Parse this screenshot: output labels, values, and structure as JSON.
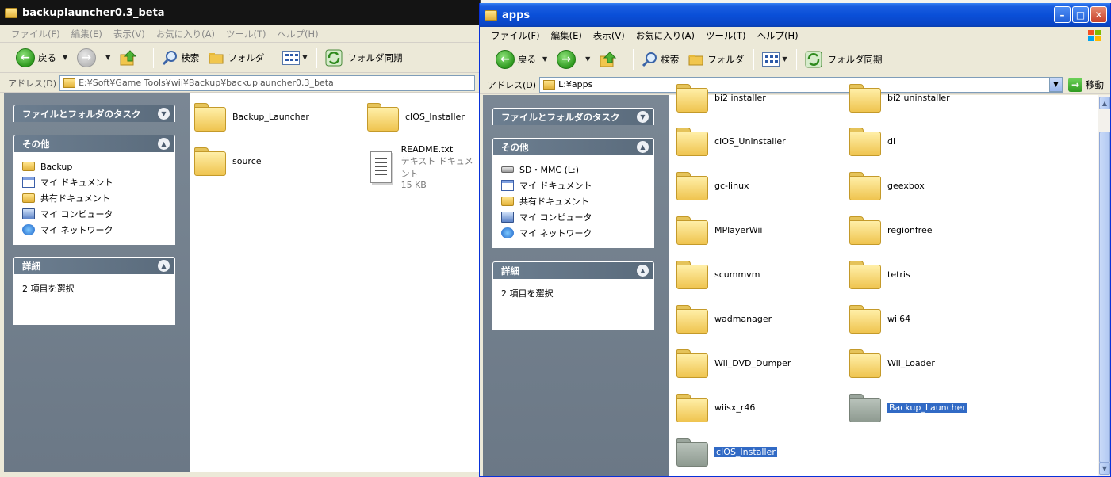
{
  "left_window": {
    "title": "backuplauncher0.3_beta",
    "menu": [
      "ファイル(F)",
      "編集(E)",
      "表示(V)",
      "お気に入り(A)",
      "ツール(T)",
      "ヘルプ(H)"
    ],
    "toolbar": {
      "back": "戻る",
      "search": "検索",
      "folders": "フォルダ",
      "sync": "フォルダ同期"
    },
    "address_label": "アドレス(D)",
    "address": "E:¥Soft¥Game Tools¥wii¥Backup¥backuplauncher0.3_beta",
    "tasks_header": "ファイルとフォルダのタスク",
    "other_header": "その他",
    "other_items": [
      "Backup",
      "マイ ドキュメント",
      "共有ドキュメント",
      "マイ コンピュータ",
      "マイ ネットワーク"
    ],
    "details_header": "詳細",
    "details_text": "2 項目を選択",
    "files": [
      {
        "name": "Backup_Launcher",
        "type": "folder"
      },
      {
        "name": "cIOS_Installer",
        "type": "folder"
      },
      {
        "name": "source",
        "type": "folder"
      },
      {
        "name": "README.txt",
        "type": "text",
        "kind": "テキスト ドキュメント",
        "size": "15 KB"
      }
    ]
  },
  "right_window": {
    "title": "apps",
    "menu": [
      "ファイル(F)",
      "編集(E)",
      "表示(V)",
      "お気に入り(A)",
      "ツール(T)",
      "ヘルプ(H)"
    ],
    "toolbar": {
      "back": "戻る",
      "search": "検索",
      "folders": "フォルダ",
      "sync": "フォルダ同期"
    },
    "address_label": "アドレス(D)",
    "address": "L:¥apps",
    "go": "移動",
    "tasks_header": "ファイルとフォルダのタスク",
    "other_header": "その他",
    "other_items": [
      "SD・MMC (L:)",
      "マイ ドキュメント",
      "共有ドキュメント",
      "マイ コンピュータ",
      "マイ ネットワーク"
    ],
    "details_header": "詳細",
    "details_text": "2 項目を選択",
    "files": [
      {
        "name": "bi2 installer"
      },
      {
        "name": "bi2 uninstaller"
      },
      {
        "name": "cIOS_Uninstaller"
      },
      {
        "name": "di"
      },
      {
        "name": "gc-linux"
      },
      {
        "name": "geexbox"
      },
      {
        "name": "MPlayerWii"
      },
      {
        "name": "regionfree"
      },
      {
        "name": "scummvm"
      },
      {
        "name": "tetris"
      },
      {
        "name": "wadmanager"
      },
      {
        "name": "wii64"
      },
      {
        "name": "Wii_DVD_Dumper"
      },
      {
        "name": "Wii_Loader"
      },
      {
        "name": "wiisx_r46"
      },
      {
        "name": "Backup_Launcher",
        "selected": true
      },
      {
        "name": "cIOS_Installer",
        "selected": true
      }
    ]
  },
  "colors": {
    "xp_blue": "#0a4fd8",
    "task_pane": "#6b7886",
    "selection": "#316ac5"
  }
}
